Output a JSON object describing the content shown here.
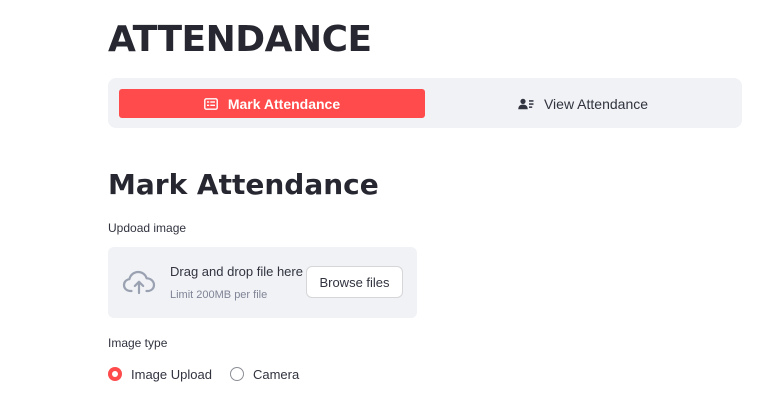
{
  "app": {
    "title": "ATTENDANCE"
  },
  "nav": {
    "items": [
      {
        "label": "Mark Attendance",
        "icon": "id-card-icon",
        "active": true
      },
      {
        "label": "View Attendance",
        "icon": "users-list-icon",
        "active": false
      }
    ],
    "active_color": "#ff4b4b",
    "bar_color": "#f0f2f6"
  },
  "section": {
    "title": "Mark Attendance"
  },
  "uploader": {
    "label": "Updoad image",
    "drag_text": "Drag and drop file here",
    "limit_text": "Limit 200MB per file",
    "browse_label": "Browse files",
    "icon": "cloud-upload-icon"
  },
  "image_type": {
    "label": "Image type",
    "options": [
      {
        "label": "Image Upload",
        "selected": true
      },
      {
        "label": "Camera",
        "selected": false
      }
    ]
  }
}
